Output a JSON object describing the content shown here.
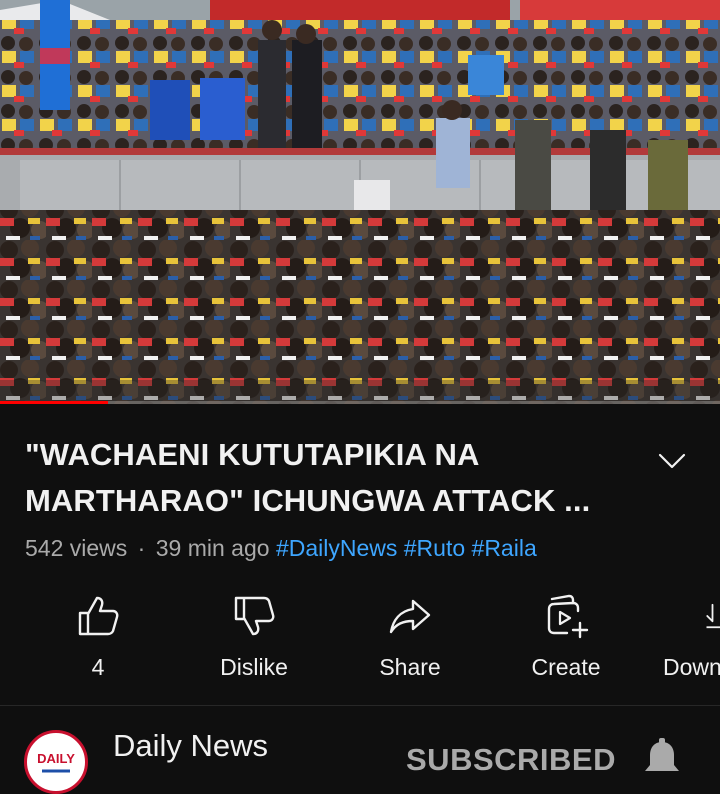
{
  "video": {
    "thumbnail_icon": "rally-crowd-scene",
    "progress_fraction": 0.15
  },
  "title": {
    "line1": "\"WACHAENI KUTUTAPIKIA NA",
    "line2": "MARTHARAO\" ICHUNGWA ATTACK ..."
  },
  "meta": {
    "views": "542 views",
    "separator": "·",
    "time": "39 min ago",
    "hashtags": [
      "#DailyNews",
      "#Ruto",
      "#Raila"
    ]
  },
  "actions": {
    "like_count": "4",
    "dislike_label": "Dislike",
    "share_label": "Share",
    "create_label": "Create",
    "download_label": "Download"
  },
  "channel": {
    "name": "Daily News",
    "avatar_text": "DAILY",
    "subscribe_label": "SUBSCRIBED"
  },
  "colors": {
    "background": "#0f0f0f",
    "hashtag": "#3ea6ff",
    "progress": "#ff0000",
    "muted": "#aaaaaa"
  }
}
